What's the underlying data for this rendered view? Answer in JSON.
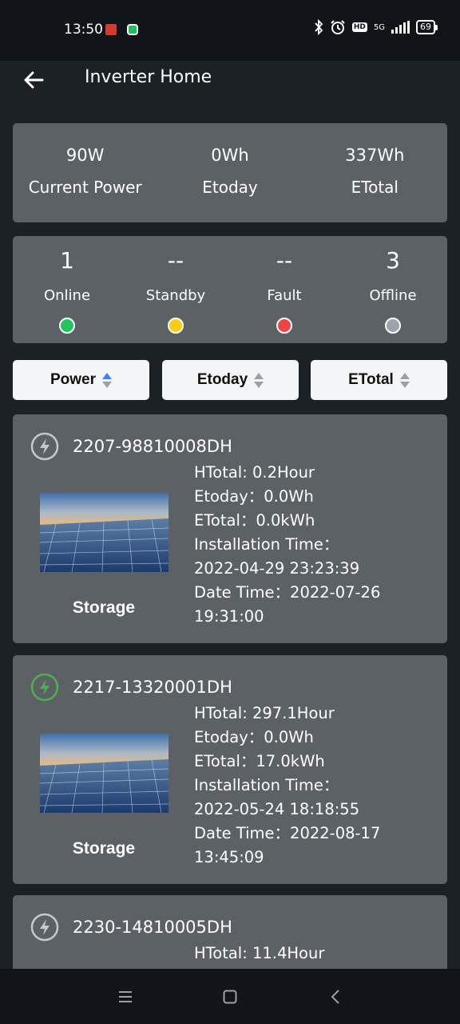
{
  "status_bar": {
    "time": "13:50",
    "network": "5G",
    "battery": "69"
  },
  "header": {
    "title": "Inverter Home"
  },
  "summary": [
    {
      "value": "90W",
      "label": "Current Power"
    },
    {
      "value": "0Wh",
      "label": "Etoday"
    },
    {
      "value": "337Wh",
      "label": "ETotal"
    }
  ],
  "status_counts": [
    {
      "count": "1",
      "label": "Online",
      "color": "#22c55e"
    },
    {
      "count": "--",
      "label": "Standby",
      "color": "#facc15"
    },
    {
      "count": "--",
      "label": "Fault",
      "color": "#ef4444"
    },
    {
      "count": "3",
      "label": "Offline",
      "color": "#9ca3af"
    }
  ],
  "sort": [
    {
      "label": "Power",
      "active": true
    },
    {
      "label": "Etoday",
      "active": false
    },
    {
      "label": "ETotal",
      "active": false
    }
  ],
  "devices": [
    {
      "serial": "2207-98810008DH",
      "type": "Storage",
      "online": false,
      "icon": "lightning-icon",
      "htotal": "HTotal: 0.2Hour",
      "etoday": "Etoday：0.0Wh",
      "etotal": "ETotal：0.0kWh",
      "install_label": "Installation Time：",
      "install_time": "2022-04-29 23:23:39",
      "date_label": "Date Time：",
      "date_date": "2022-07-26",
      "date_time": "19:31:00"
    },
    {
      "serial": "2217-13320001DH",
      "type": "Storage",
      "online": true,
      "icon": "lightning-icon",
      "htotal": "HTotal: 297.1Hour",
      "etoday": "Etoday：0.0Wh",
      "etotal": "ETotal：17.0kWh",
      "install_label": "Installation Time：",
      "install_time": "2022-05-24 18:18:55",
      "date_label": "Date Time：",
      "date_date": "2022-08-17",
      "date_time": "13:45:09"
    },
    {
      "serial": "2230-14810005DH",
      "online": false,
      "icon": "lightning-icon",
      "htotal": "HTotal: 11.4Hour"
    }
  ],
  "colors": {
    "background": "#1c2126",
    "card": "#5c6166",
    "online_icon": "#4caf50",
    "offline_icon": "#c5c8cc",
    "sort_active": "#3b82f6"
  }
}
